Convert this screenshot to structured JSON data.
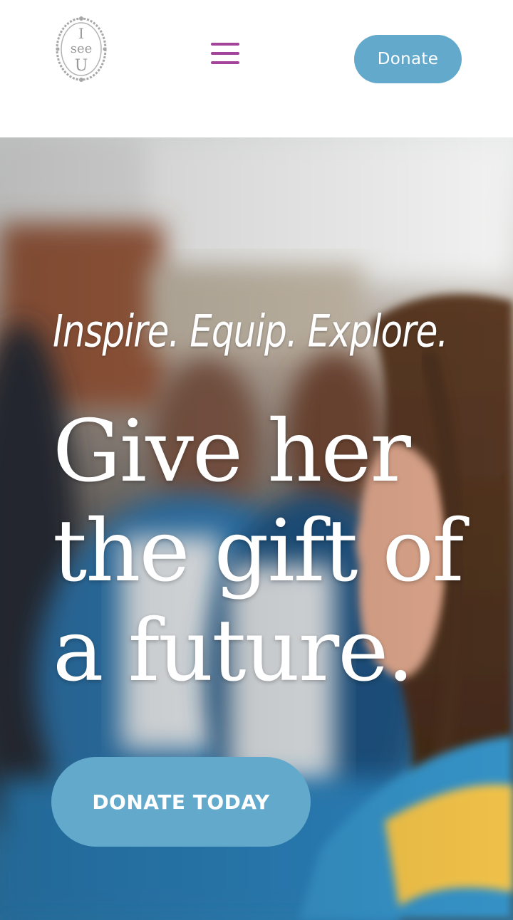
{
  "header": {
    "logo_text": [
      "I",
      "see",
      "U"
    ],
    "menu_icon": "hamburger-menu-icon",
    "donate_label": "Donate"
  },
  "hero": {
    "tagline": "Inspire. Equip. Explore.",
    "headline": "Give her the gift of a future.",
    "cta_label": "DONATE TODAY"
  },
  "colors": {
    "accent_blue": "#62a9cb",
    "menu_purple": "#a3449a",
    "logo_gray": "#9a9a9a",
    "text_white": "#ffffff"
  }
}
